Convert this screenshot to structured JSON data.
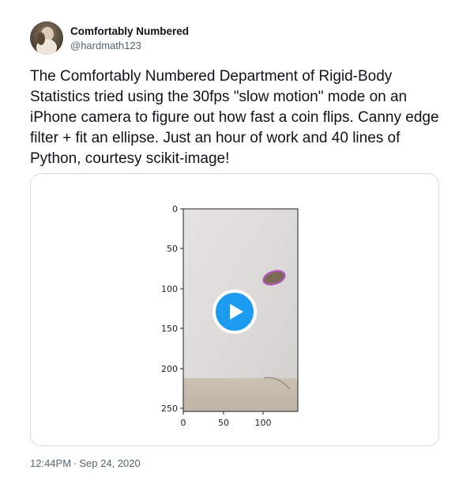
{
  "author": {
    "display_name": "Comfortably Numbered",
    "handle": "@hardmath123",
    "avatar_icon": "avatar-photo-icon"
  },
  "tweet": {
    "text": "The Comfortably Numbered Department of Rigid-Body Statistics tried using the 30fps \"slow motion\" mode on an iPhone camera to figure out how fast a coin flips. Canny edge filter + fit an ellipse. Just an hour of work and 40 lines of Python, courtesy scikit-image!"
  },
  "media": {
    "type": "video",
    "play_icon": "play-icon",
    "accent_color": "#1d9bf0",
    "frame_plot": {
      "y_ticks": [
        "0",
        "50",
        "100",
        "150",
        "200",
        "250"
      ],
      "x_ticks": [
        "0",
        "50",
        "100"
      ],
      "ellipse_color": "#b04fc4"
    }
  },
  "footer": {
    "time": "12:44PM",
    "separator": "·",
    "date": "Sep 24, 2020"
  }
}
